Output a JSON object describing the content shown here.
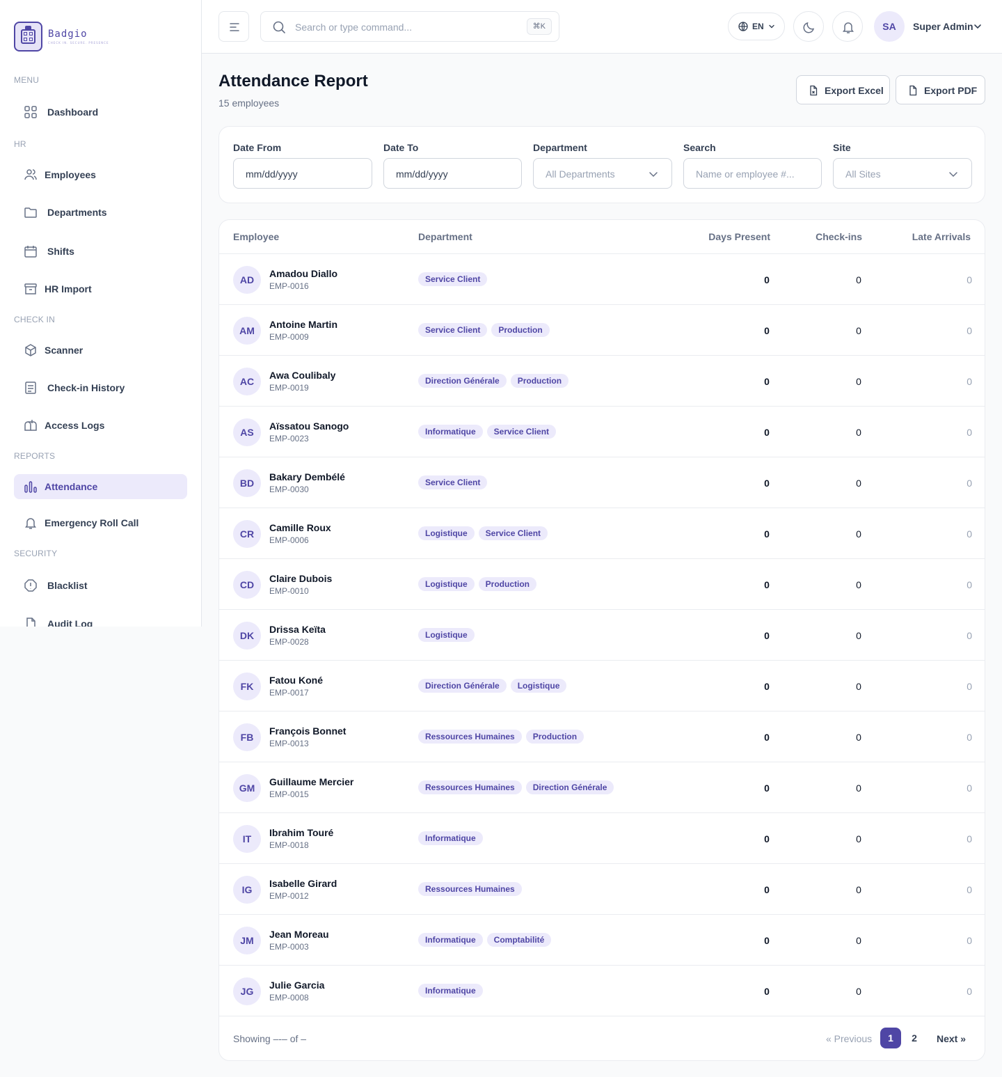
{
  "app": {
    "brand_name": "Badgio",
    "brand_tagline": "CHECK IN. SECURE. PRESENCE"
  },
  "sidebar": {
    "sections": {
      "menu": "MENU",
      "hr": "HR",
      "check_in": "CHECK IN",
      "reports": "REPORTS",
      "security": "SECURITY"
    },
    "items": {
      "dashboard": "Dashboard",
      "employees": "Employees",
      "departments": "Departments",
      "shifts": "Shifts",
      "hr_import": "HR Import",
      "scanner": "Scanner",
      "checkin_history": "Check-in History",
      "access_logs": "Access Logs",
      "attendance": "Attendance",
      "emergency_roll_call": "Emergency Roll Call",
      "blacklist": "Blacklist",
      "audit_log": "Audit Log"
    },
    "active_item": "attendance"
  },
  "header": {
    "search_placeholder": "Search or type command...",
    "search_shortcut": "⌘K",
    "language": "EN",
    "user_initials": "SA",
    "user_name": "Super Admin"
  },
  "page": {
    "title": "Attendance Report",
    "subtitle": "15 employees",
    "export_excel": "Export Excel",
    "export_pdf": "Export PDF"
  },
  "filters": {
    "date_from_label": "Date From",
    "date_from_value": "mm/dd/yyyy",
    "date_to_label": "Date To",
    "date_to_value": "mm/dd/yyyy",
    "department_label": "Department",
    "department_value": "All Departments",
    "search_label": "Search",
    "search_placeholder": "Name or employee #...",
    "site_label": "Site",
    "site_value": "All Sites"
  },
  "table": {
    "headers": {
      "employee": "Employee",
      "department": "Department",
      "days_present": "Days Present",
      "checkins": "Check-ins",
      "late_arrivals": "Late Arrivals"
    },
    "rows": [
      {
        "initials": "AD",
        "name": "Amadou Diallo",
        "code": "EMP-0016",
        "departments": [
          "Service Client"
        ],
        "days_present": "0",
        "checkins": "0",
        "late": "0"
      },
      {
        "initials": "AM",
        "name": "Antoine Martin",
        "code": "EMP-0009",
        "departments": [
          "Service Client",
          "Production"
        ],
        "days_present": "0",
        "checkins": "0",
        "late": "0"
      },
      {
        "initials": "AC",
        "name": "Awa Coulibaly",
        "code": "EMP-0019",
        "departments": [
          "Direction Générale",
          "Production"
        ],
        "days_present": "0",
        "checkins": "0",
        "late": "0"
      },
      {
        "initials": "AS",
        "name": "Aïssatou Sanogo",
        "code": "EMP-0023",
        "departments": [
          "Informatique",
          "Service Client"
        ],
        "days_present": "0",
        "checkins": "0",
        "late": "0"
      },
      {
        "initials": "BD",
        "name": "Bakary Dembélé",
        "code": "EMP-0030",
        "departments": [
          "Service Client"
        ],
        "days_present": "0",
        "checkins": "0",
        "late": "0"
      },
      {
        "initials": "CR",
        "name": "Camille Roux",
        "code": "EMP-0006",
        "departments": [
          "Logistique",
          "Service Client"
        ],
        "days_present": "0",
        "checkins": "0",
        "late": "0"
      },
      {
        "initials": "CD",
        "name": "Claire Dubois",
        "code": "EMP-0010",
        "departments": [
          "Logistique",
          "Production"
        ],
        "days_present": "0",
        "checkins": "0",
        "late": "0"
      },
      {
        "initials": "DK",
        "name": "Drissa Keïta",
        "code": "EMP-0028",
        "departments": [
          "Logistique"
        ],
        "days_present": "0",
        "checkins": "0",
        "late": "0"
      },
      {
        "initials": "FK",
        "name": "Fatou Koné",
        "code": "EMP-0017",
        "departments": [
          "Direction Générale",
          "Logistique"
        ],
        "days_present": "0",
        "checkins": "0",
        "late": "0"
      },
      {
        "initials": "FB",
        "name": "François Bonnet",
        "code": "EMP-0013",
        "departments": [
          "Ressources Humaines",
          "Production"
        ],
        "days_present": "0",
        "checkins": "0",
        "late": "0"
      },
      {
        "initials": "GM",
        "name": "Guillaume Mercier",
        "code": "EMP-0015",
        "departments": [
          "Ressources Humaines",
          "Direction Générale"
        ],
        "days_present": "0",
        "checkins": "0",
        "late": "0"
      },
      {
        "initials": "IT",
        "name": "Ibrahim Touré",
        "code": "EMP-0018",
        "departments": [
          "Informatique"
        ],
        "days_present": "0",
        "checkins": "0",
        "late": "0"
      },
      {
        "initials": "IG",
        "name": "Isabelle Girard",
        "code": "EMP-0012",
        "departments": [
          "Ressources Humaines"
        ],
        "days_present": "0",
        "checkins": "0",
        "late": "0"
      },
      {
        "initials": "JM",
        "name": "Jean Moreau",
        "code": "EMP-0003",
        "departments": [
          "Informatique",
          "Comptabilité"
        ],
        "days_present": "0",
        "checkins": "0",
        "late": "0"
      },
      {
        "initials": "JG",
        "name": "Julie Garcia",
        "code": "EMP-0008",
        "departments": [
          "Informatique"
        ],
        "days_present": "0",
        "checkins": "0",
        "late": "0"
      }
    ]
  },
  "pagination": {
    "showing": "Showing –-– of –",
    "previous": "« Previous",
    "pages": [
      "1",
      "2"
    ],
    "current_page": "1",
    "next": "Next »"
  },
  "colors": {
    "accent": "#4f46a5",
    "accent_light": "#eceafb"
  }
}
